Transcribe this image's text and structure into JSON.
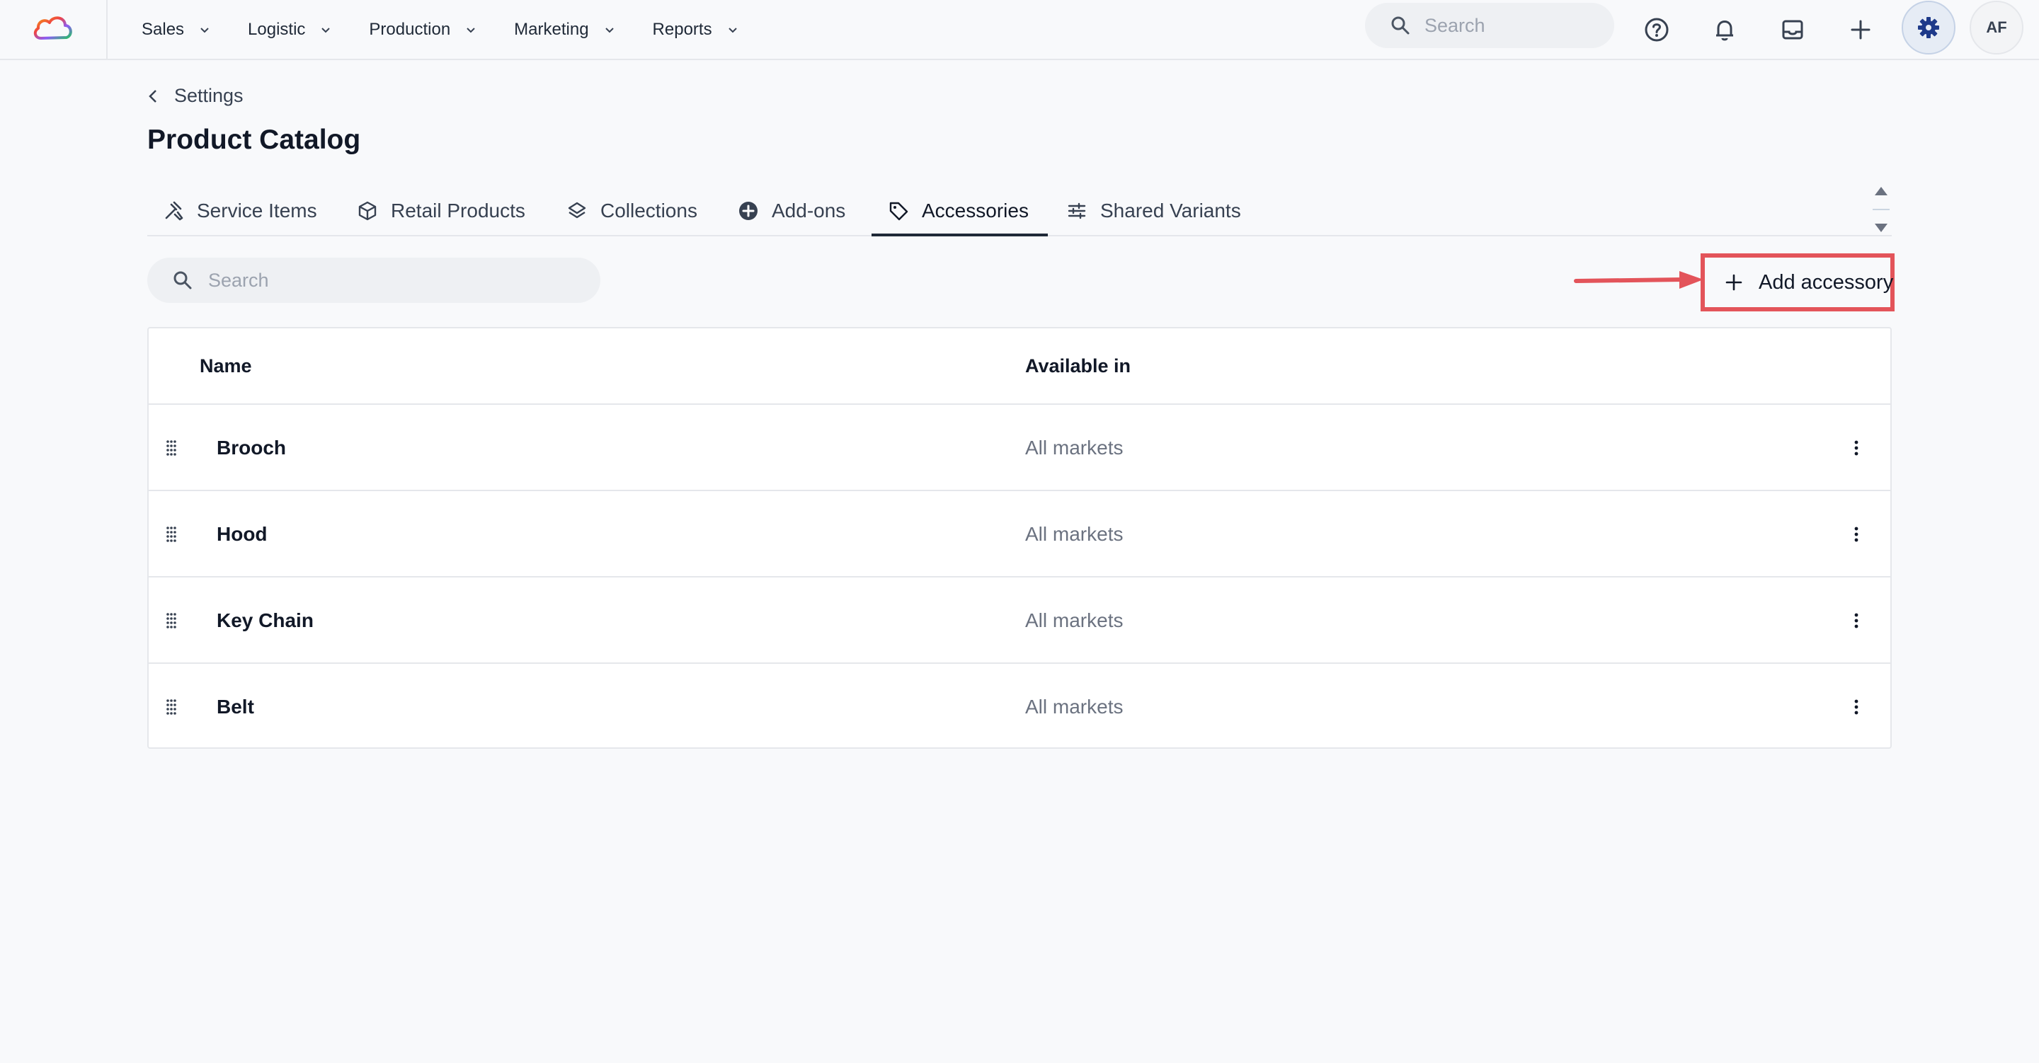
{
  "topbar": {
    "logo_icon": "cloud-logo-icon",
    "nav": [
      {
        "label": "Sales"
      },
      {
        "label": "Logistic"
      },
      {
        "label": "Production"
      },
      {
        "label": "Marketing"
      },
      {
        "label": "Reports"
      }
    ],
    "search_placeholder": "Search",
    "avatar_initials": "AF",
    "icons": [
      "help-icon",
      "bell-icon",
      "inbox-icon",
      "plus-icon",
      "gear-icon"
    ]
  },
  "page": {
    "breadcrumb": "Settings",
    "title": "Product Catalog"
  },
  "tabs": [
    {
      "label": "Service Items",
      "icon": "tools-icon"
    },
    {
      "label": "Retail Products",
      "icon": "box-icon"
    },
    {
      "label": "Collections",
      "icon": "layers-icon"
    },
    {
      "label": "Add-ons",
      "icon": "plus-circle-icon"
    },
    {
      "label": "Accessories",
      "icon": "tag-icon",
      "active": true
    },
    {
      "label": "Shared Variants",
      "icon": "sliders-icon"
    }
  ],
  "toolbar": {
    "search_placeholder": "Search",
    "add_label": "Add accessory",
    "annotation_color": "#e3545a"
  },
  "table": {
    "columns": [
      "Name",
      "Available in"
    ],
    "rows": [
      {
        "name": "Brooch",
        "available": "All markets"
      },
      {
        "name": "Hood",
        "available": "All markets"
      },
      {
        "name": "Key Chain",
        "available": "All markets"
      },
      {
        "name": "Belt",
        "available": "All markets"
      }
    ]
  }
}
